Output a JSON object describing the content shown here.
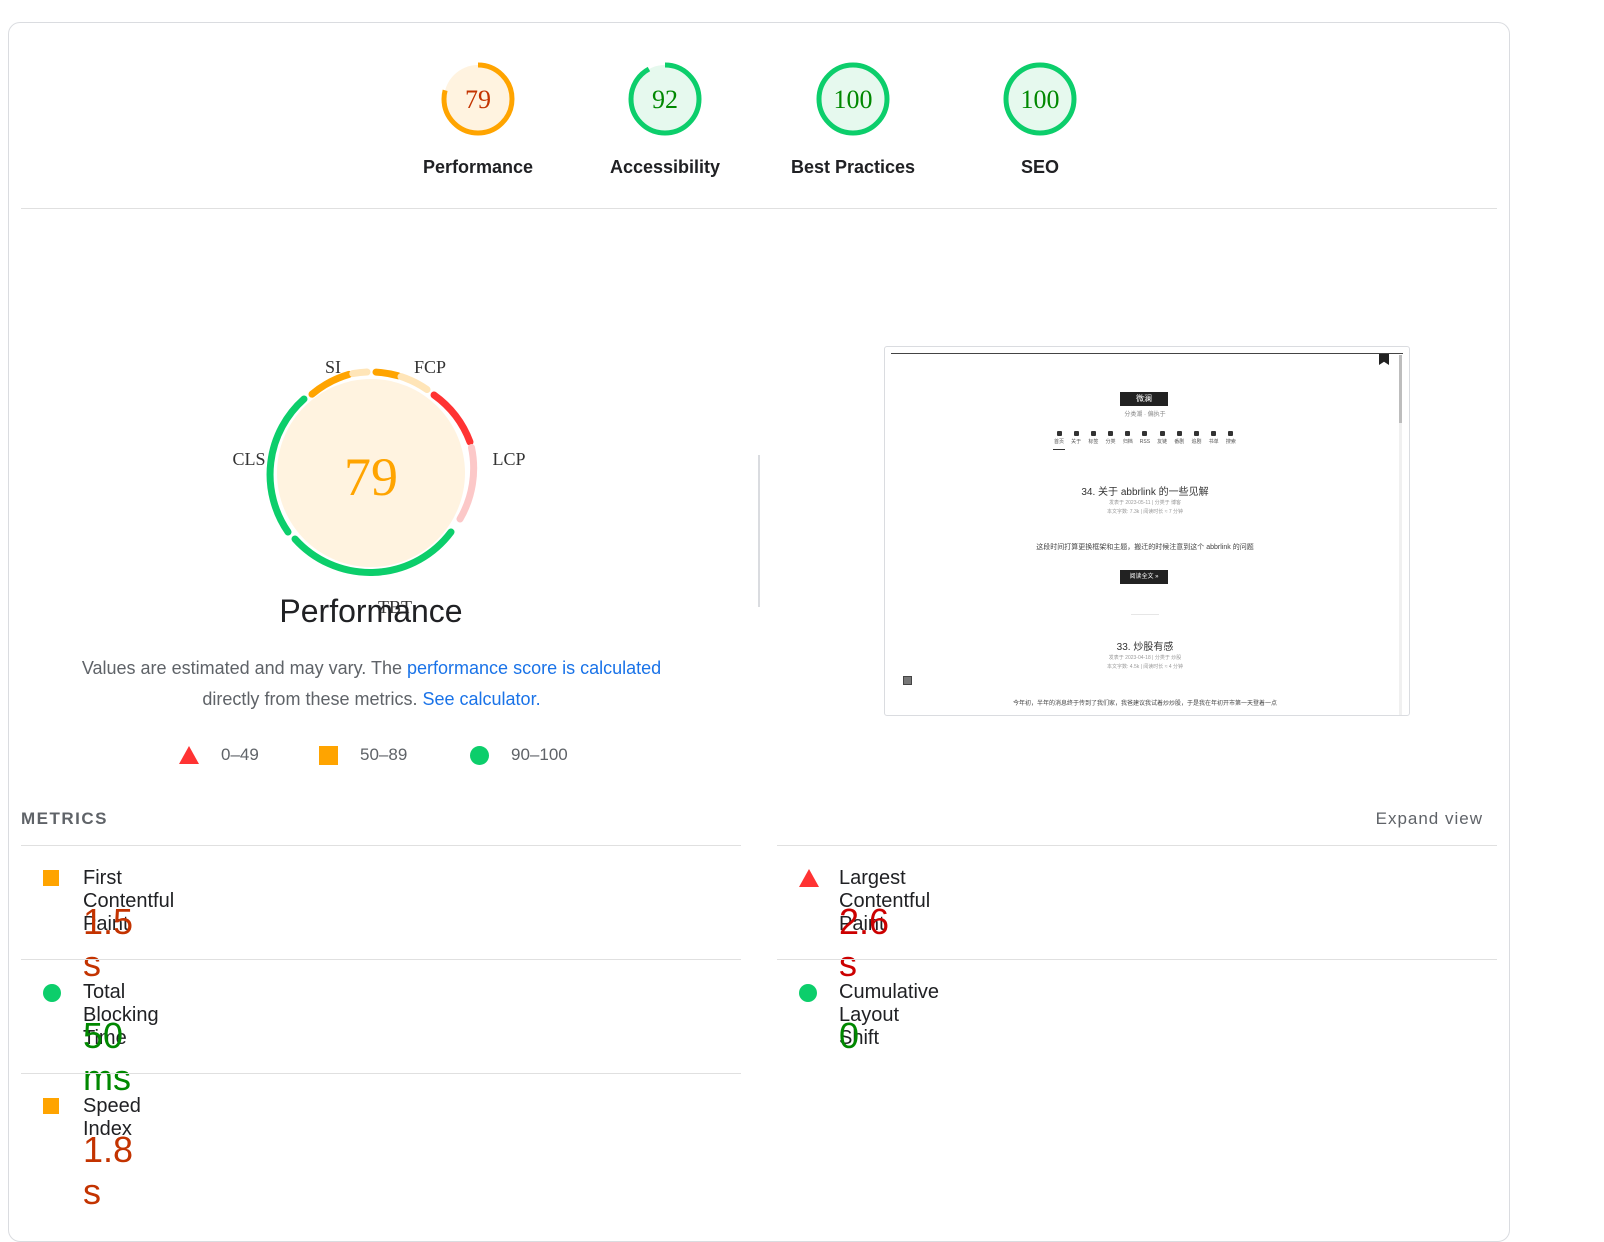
{
  "categories": [
    {
      "label": "Performance",
      "score": "79",
      "level": 0.79,
      "color": "#ffa400",
      "fill": "#fff3e0",
      "text_color": "#c33300"
    },
    {
      "label": "Accessibility",
      "score": "92",
      "level": 0.92,
      "color": "#0cce6b",
      "fill": "#e6f9ee",
      "text_color": "#008800"
    },
    {
      "label": "Best Practices",
      "score": "100",
      "level": 1.0,
      "color": "#0cce6b",
      "fill": "#e6f9ee",
      "text_color": "#008800"
    },
    {
      "label": "SEO",
      "score": "100",
      "level": 1.0,
      "color": "#0cce6b",
      "fill": "#e6f9ee",
      "text_color": "#008800"
    }
  ],
  "main_gauge": {
    "score": "79",
    "title": "Performance",
    "segment_labels": {
      "si": "SI",
      "fcp": "FCP",
      "lcp": "LCP",
      "tbt": "TBT",
      "cls": "CLS"
    }
  },
  "description": {
    "part1": "Values are estimated and may vary. The ",
    "link1": "performance score is calculated",
    "part2": " directly from these metrics.",
    "link2": "See calculator."
  },
  "legend": [
    {
      "range": "0–49",
      "shape": "triangle",
      "color": "#ff3333"
    },
    {
      "range": "50–89",
      "shape": "square",
      "color": "#ffa400"
    },
    {
      "range": "90–100",
      "shape": "circle",
      "color": "#0cce6b"
    }
  ],
  "thumbnail": {
    "site_title": "微澜",
    "site_sub": "分类潮 · 偏执于",
    "nav": [
      "首页",
      "关于",
      "标签",
      "分类",
      "归档",
      "RSS",
      "友链",
      "番剧",
      "追剧",
      "书单",
      "搜索"
    ],
    "post1_title": "34. 关于 abbrlink 的一些见解",
    "post1_meta": "发表于 2023-05-11 | 分类于 博客",
    "post1_meta2": "本文字数: 7.3k | 阅读时长 ≈ 7 分钟",
    "post1_excerpt": "这段时间打算更换框架和主题，搬迁的时候注意到这个 abbrlink 的问题",
    "read_more": "阅读全文 »",
    "post2_title": "33. 炒股有感",
    "post2_meta": "发表于 2023-04-18 | 分类于 炒股",
    "post2_meta2": "本文字数: 4.5k | 阅读时长 ≈ 4 分钟",
    "post2_excerpt": "今年初，半年的消息终于传到了我们家，我爸建议我试着炒炒股，于是我在年初开市第一天登着一点"
  },
  "metrics": {
    "heading": "METRICS",
    "expand": "Expand view",
    "items": [
      {
        "name": "First Contentful Paint",
        "value": "1.5 s",
        "rating": "average"
      },
      {
        "name": "Largest Contentful Paint",
        "value": "2.6 s",
        "rating": "fail"
      },
      {
        "name": "Total Blocking Time",
        "value": "50 ms",
        "rating": "pass"
      },
      {
        "name": "Cumulative Layout Shift",
        "value": "0",
        "rating": "pass"
      },
      {
        "name": "Speed Index",
        "value": "1.8 s",
        "rating": "average"
      }
    ]
  }
}
